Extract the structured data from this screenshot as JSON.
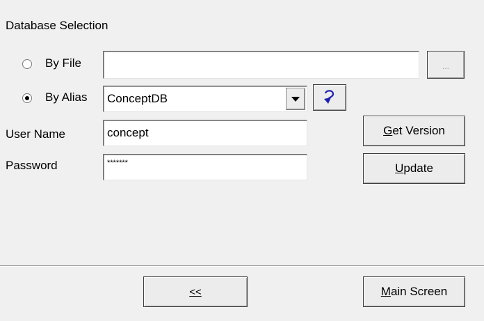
{
  "section_title": "Database Selection",
  "by_file": {
    "label": "By File",
    "selected": false,
    "value": "",
    "browse_label": "..."
  },
  "by_alias": {
    "label": "By Alias",
    "selected": true,
    "value": "ConceptDB",
    "refresh_icon": "refresh-icon"
  },
  "user_name": {
    "label": "User Name",
    "value": "concept"
  },
  "password": {
    "label": "Password",
    "value": "*******"
  },
  "buttons": {
    "get_version": {
      "mnemonic": "G",
      "rest": "et Version"
    },
    "update": {
      "mnemonic": "U",
      "rest": "pdate"
    },
    "back": {
      "label": "<<"
    },
    "main_screen": {
      "mnemonic": "M",
      "rest": "ain Screen"
    }
  }
}
